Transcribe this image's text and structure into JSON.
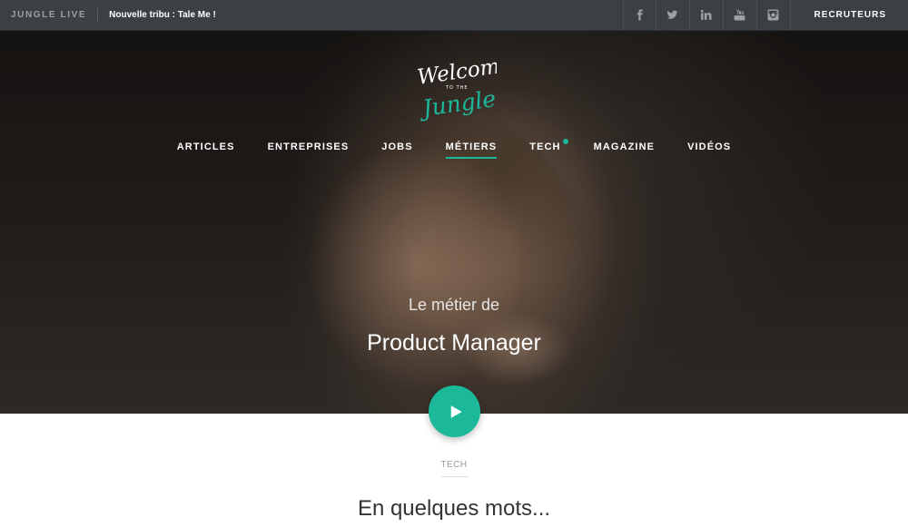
{
  "topbar": {
    "brand": "JUNGLE LIVE",
    "news": "Nouvelle tribu : Tale Me !",
    "social": [
      "facebook-icon",
      "twitter-icon",
      "linkedin-icon",
      "youtube-icon",
      "instagram-icon"
    ],
    "recruteurs": "RECRUTEURS"
  },
  "logo": {
    "line1": "Welcome",
    "line2": "TO THE",
    "line3": "Jungle"
  },
  "nav": {
    "items": [
      "ARTICLES",
      "ENTREPRISES",
      "JOBS",
      "MÉTIERS",
      "TECH",
      "MAGAZINE",
      "VIDÉOS"
    ],
    "active": "MÉTIERS"
  },
  "hero": {
    "subtitle": "Le métier de",
    "title": "Product Manager"
  },
  "play_button": {
    "icon": "play-icon"
  },
  "content": {
    "category": "TECH",
    "section_title": "En quelques mots..."
  },
  "colors": {
    "accent": "#1bb99a",
    "topbar_bg": "#3c3f44"
  }
}
